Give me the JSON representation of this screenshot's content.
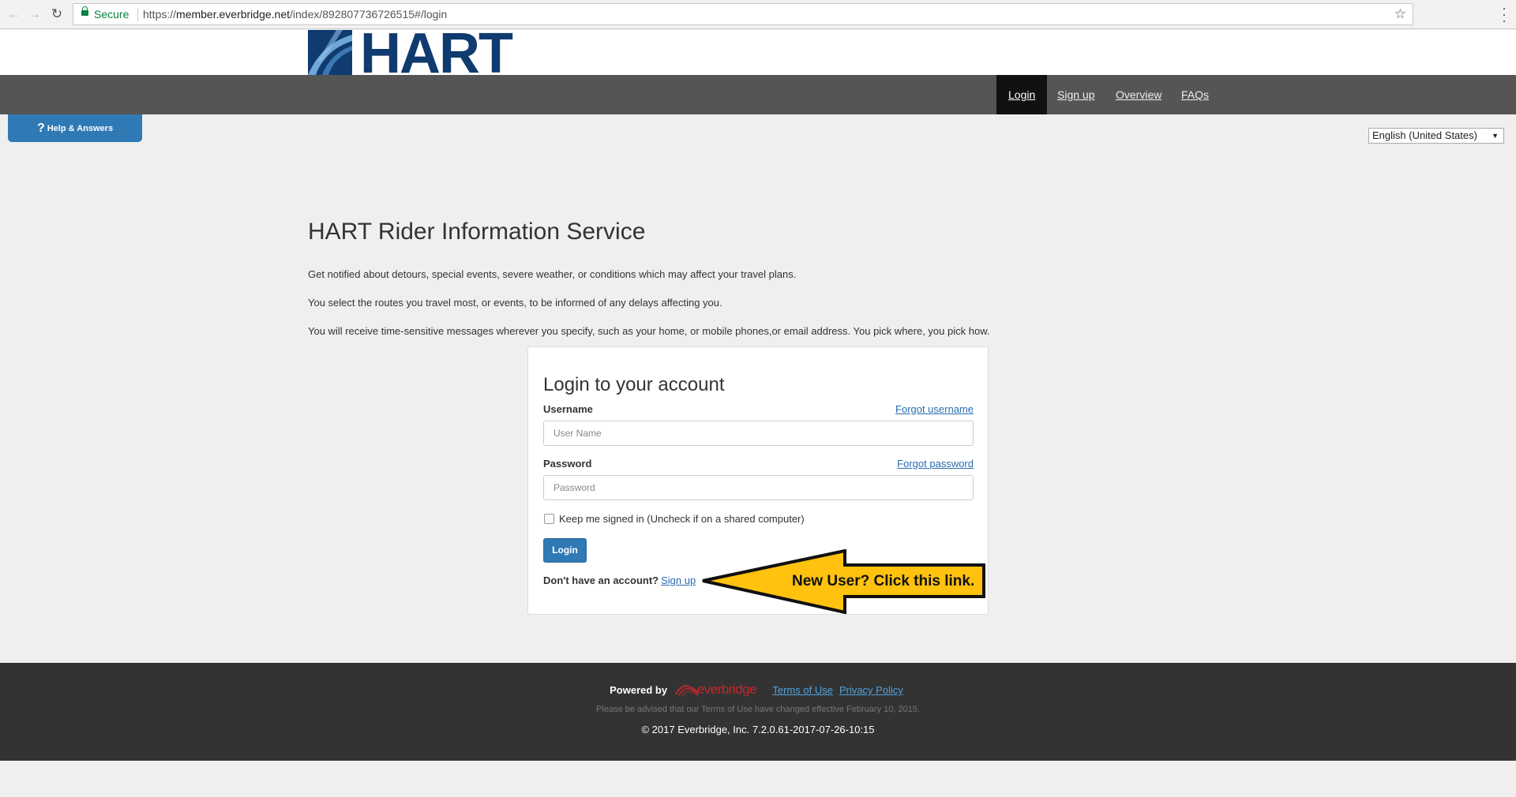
{
  "browser": {
    "secure_label": "Secure",
    "url_prefix": "https://",
    "url_host": "member.everbridge.net",
    "url_path": "/index/892807736726515#/login"
  },
  "header": {
    "logo_text": "HART",
    "nav": [
      "Login",
      "Sign up",
      "Overview",
      "FAQs"
    ]
  },
  "help_button": {
    "label": "Help & Answers"
  },
  "language": {
    "selected": "English (United States)"
  },
  "main": {
    "title": "HART Rider Information Service",
    "paragraphs": [
      "Get notified about detours, special events, severe weather, or conditions which may affect your travel plans.",
      "You select the routes you travel most, or events, to be informed of any delays affecting you.",
      "You will receive time-sensitive messages wherever you specify, such as your home, or mobile  phones,or email address. You pick where, you pick how."
    ]
  },
  "login": {
    "title": "Login to your account",
    "username_label": "Username",
    "forgot_username": "Forgot username",
    "username_placeholder": "User Name",
    "password_label": "Password",
    "forgot_password": "Forgot password",
    "password_placeholder": "Password",
    "keep_signed_in": "Keep me signed in (Uncheck if on a shared computer)",
    "login_button": "Login",
    "no_account": "Don't have an account?",
    "sign_up_link": "Sign up"
  },
  "callout": {
    "text": "New User? Click this link.",
    "color": "#ffc20e"
  },
  "footer": {
    "powered_by": "Powered by",
    "brand": "everbridge",
    "terms": "Terms of Use",
    "privacy": "Privacy Policy",
    "advisory": "Please be advised that our Terms of Use have changed effective February 10, 2015.",
    "copyright": "© 2017 Everbridge, Inc. 7.2.0.61-2017-07-26-10:15"
  },
  "colors": {
    "brand_blue": "#0f3b6f",
    "button_blue": "#2f79b5",
    "nav_bg": "#555555",
    "footer_bg": "#333333"
  }
}
